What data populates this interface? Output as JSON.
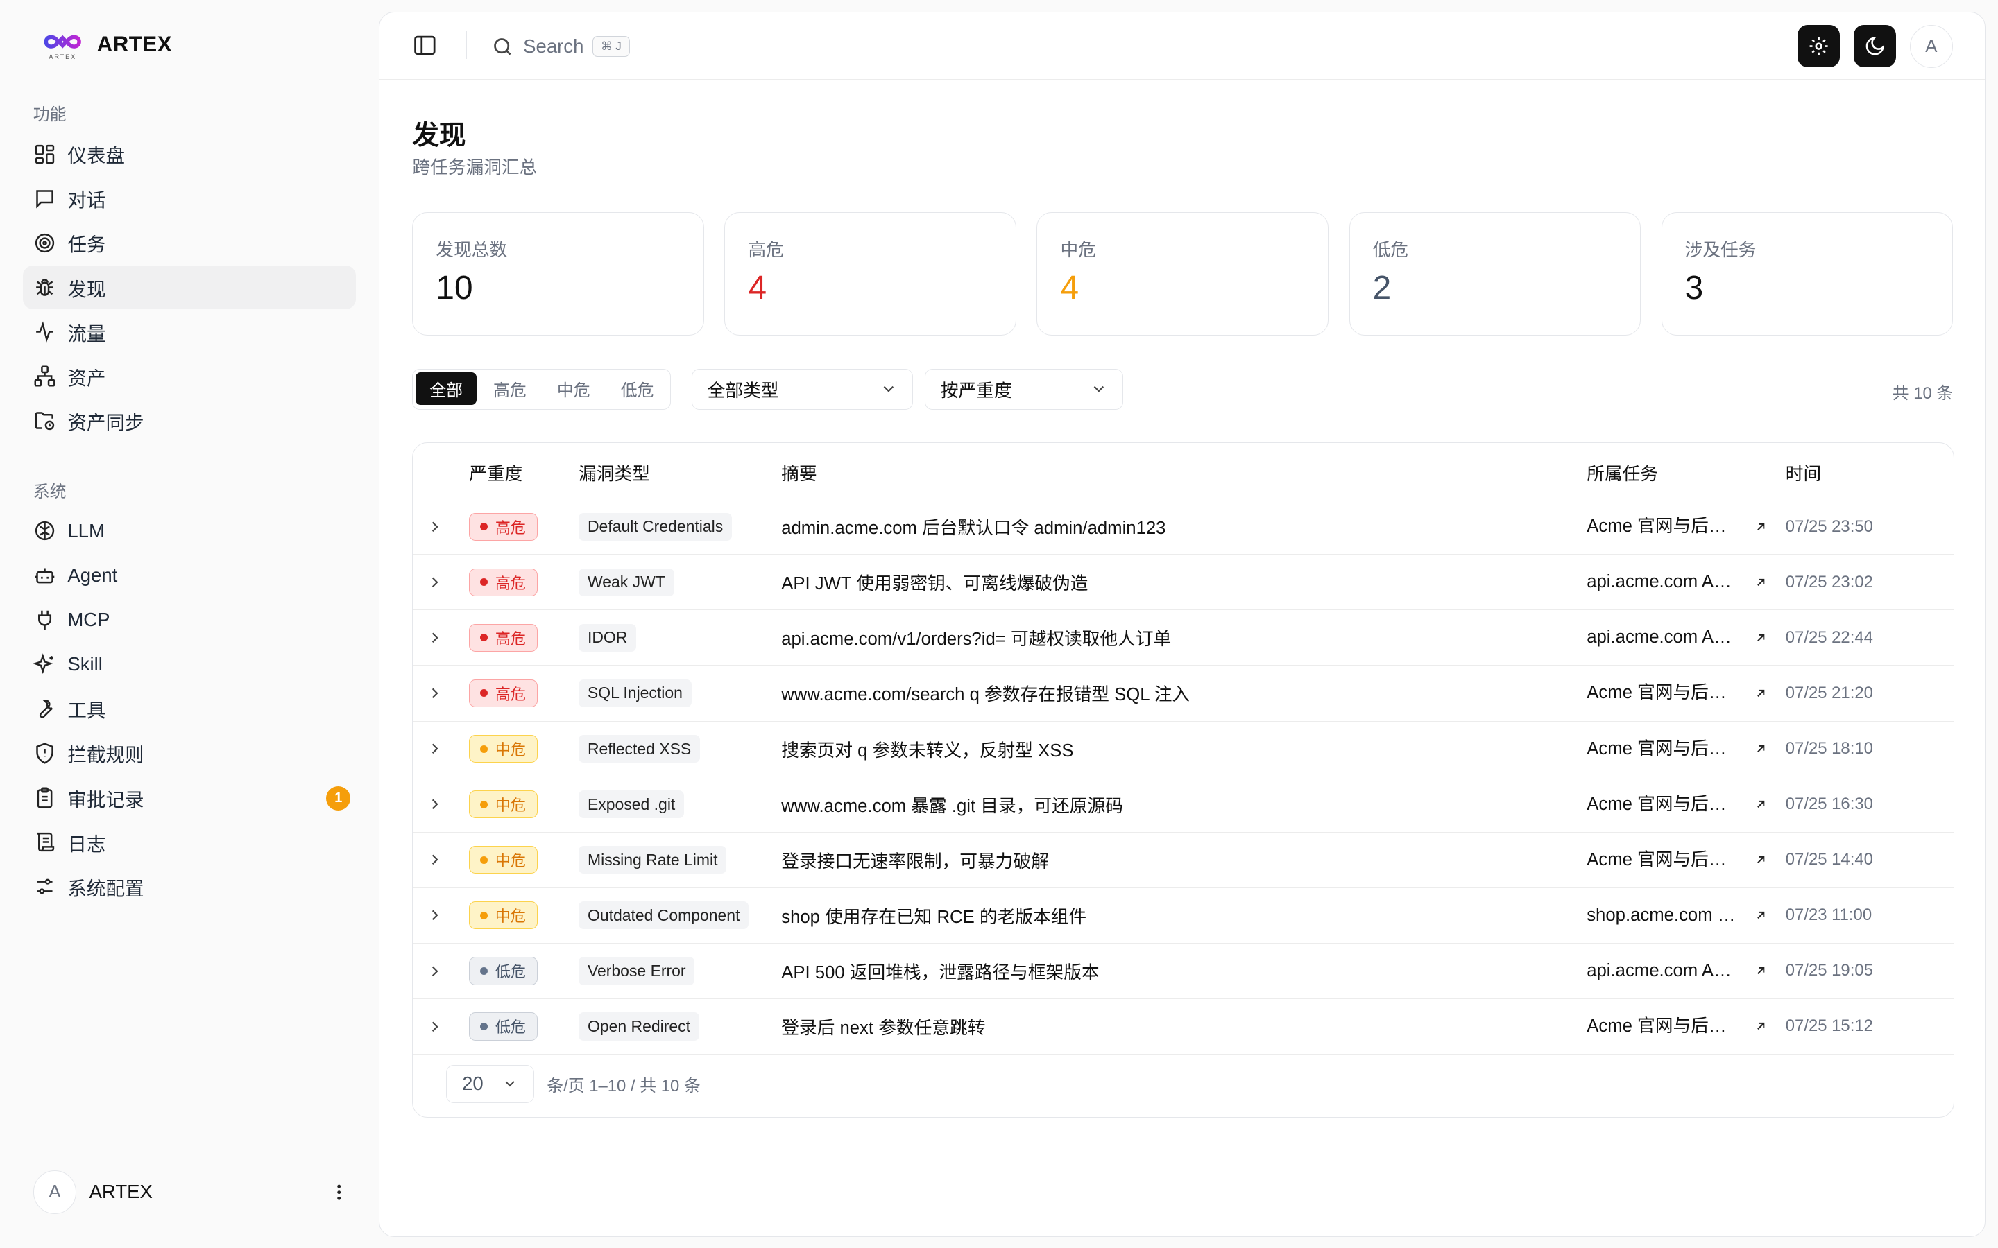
{
  "brand": {
    "name": "ARTEX",
    "logo_sub": "ARTEX"
  },
  "sidebar": {
    "sections": [
      {
        "label": "功能",
        "items": [
          {
            "label": "仪表盘",
            "icon": "dashboard-icon"
          },
          {
            "label": "对话",
            "icon": "chat-icon"
          },
          {
            "label": "任务",
            "icon": "target-icon"
          },
          {
            "label": "发现",
            "icon": "bug-icon",
            "active": true
          },
          {
            "label": "流量",
            "icon": "activity-icon"
          },
          {
            "label": "资产",
            "icon": "network-icon"
          },
          {
            "label": "资产同步",
            "icon": "folder-sync-icon"
          }
        ]
      },
      {
        "label": "系统",
        "items": [
          {
            "label": "LLM",
            "icon": "brain-icon"
          },
          {
            "label": "Agent",
            "icon": "bot-icon"
          },
          {
            "label": "MCP",
            "icon": "plug-icon"
          },
          {
            "label": "Skill",
            "icon": "sparkles-icon"
          },
          {
            "label": "工具",
            "icon": "wrench-icon"
          },
          {
            "label": "拦截规则",
            "icon": "shield-icon"
          },
          {
            "label": "审批记录",
            "icon": "clipboard-icon",
            "badge": "1"
          },
          {
            "label": "日志",
            "icon": "scroll-icon"
          },
          {
            "label": "系统配置",
            "icon": "sliders-icon"
          }
        ]
      }
    ],
    "user": {
      "avatar": "A",
      "name": "ARTEX"
    }
  },
  "topbar": {
    "search_label": "Search",
    "search_kbd": "⌘ J",
    "avatar": "A"
  },
  "page": {
    "title": "发现",
    "subtitle": "跨任务漏洞汇总"
  },
  "stats": [
    {
      "label": "发现总数",
      "value": "10",
      "color": "#111111"
    },
    {
      "label": "高危",
      "value": "4",
      "color": "#dc2626"
    },
    {
      "label": "中危",
      "value": "4",
      "color": "#f59e0b"
    },
    {
      "label": "低危",
      "value": "2",
      "color": "#475569"
    },
    {
      "label": "涉及任务",
      "value": "3",
      "color": "#111111"
    }
  ],
  "filters": {
    "segments": [
      "全部",
      "高危",
      "中危",
      "低危"
    ],
    "active_segment": 0,
    "type_select": "全部类型",
    "sort_select": "按严重度",
    "total": "共 10 条"
  },
  "table": {
    "columns": [
      "严重度",
      "漏洞类型",
      "摘要",
      "所属任务",
      "时间"
    ],
    "rows": [
      {
        "severity": "高危",
        "level": "high",
        "type": "Default Credentials",
        "summary": "admin.acme.com 后台默认口令 admin/admin123",
        "task": "Acme 官网与后台渗透测试",
        "time": "07/25 23:50"
      },
      {
        "severity": "高危",
        "level": "high",
        "type": "Weak JWT",
        "summary": "API JWT 使用弱密钥、可离线爆破伪造",
        "task": "api.acme.com API 测试",
        "time": "07/25 23:02"
      },
      {
        "severity": "高危",
        "level": "high",
        "type": "IDOR",
        "summary": "api.acme.com/v1/orders?id= 可越权读取他人订单",
        "task": "api.acme.com API 测试",
        "time": "07/25 22:44"
      },
      {
        "severity": "高危",
        "level": "high",
        "type": "SQL Injection",
        "summary": "www.acme.com/search q 参数存在报错型 SQL 注入",
        "task": "Acme 官网与后台渗透测试",
        "time": "07/25 21:20"
      },
      {
        "severity": "中危",
        "level": "med",
        "type": "Reflected XSS",
        "summary": "搜索页对 q 参数未转义，反射型 XSS",
        "task": "Acme 官网与后台渗透测试",
        "time": "07/25 18:10"
      },
      {
        "severity": "中危",
        "level": "med",
        "type": "Exposed .git",
        "summary": "www.acme.com 暴露 .git 目录，可还原源码",
        "task": "Acme 官网与后台渗透测试",
        "time": "07/25 16:30"
      },
      {
        "severity": "中危",
        "level": "med",
        "type": "Missing Rate Limit",
        "summary": "登录接口无速率限制，可暴力破解",
        "task": "Acme 官网与后台渗透测试",
        "time": "07/25 14:40"
      },
      {
        "severity": "中危",
        "level": "med",
        "type": "Outdated Component",
        "summary": "shop 使用存在已知 RCE 的老版本组件",
        "task": "shop.acme.com 组件扫描",
        "time": "07/23 11:00"
      },
      {
        "severity": "低危",
        "level": "low",
        "type": "Verbose Error",
        "summary": "API 500 返回堆栈，泄露路径与框架版本",
        "task": "api.acme.com API 测试",
        "time": "07/25 19:05"
      },
      {
        "severity": "低危",
        "level": "low",
        "type": "Open Redirect",
        "summary": "登录后 next 参数任意跳转",
        "task": "Acme 官网与后台渗透测试",
        "time": "07/25 15:12"
      }
    ]
  },
  "pager": {
    "page_size": "20",
    "text": "条/页  1–10 / 共 10 条"
  }
}
